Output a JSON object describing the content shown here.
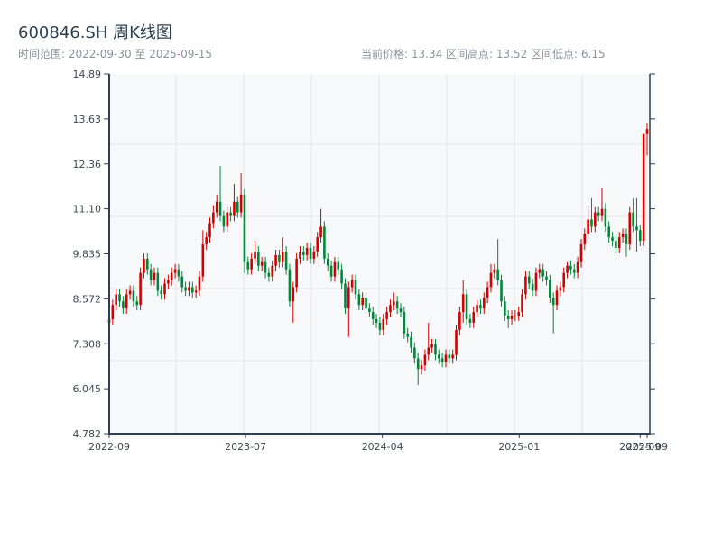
{
  "header": {
    "title": "600846.SH 周K线图",
    "range_text": "时间范围: 2022-09-30 至 2025-09-15",
    "stats_text": "当前价格: 13.34  区间高点: 13.52  区间低点: 6.15"
  },
  "chart_data": {
    "type": "candlestick",
    "title": "600846.SH 周K线图",
    "frequency": "weekly",
    "x_range": [
      "2022-09-30",
      "2025-09-15"
    ],
    "ylim": [
      4.782,
      14.89
    ],
    "y_ticks": [
      "14.89",
      "13.63",
      "12.36",
      "11.10",
      "9.835",
      "8.572",
      "7.308",
      "6.045",
      "4.782"
    ],
    "x_ticks": [
      {
        "label": "2022-09",
        "date": "2022-09-30"
      },
      {
        "label": "2023-07",
        "date": "2023-07-01"
      },
      {
        "label": "2024-04",
        "date": "2024-04-01"
      },
      {
        "label": "2025-01",
        "date": "2025-01-01"
      },
      {
        "label": "2025-09",
        "date": "2025-09-01"
      },
      {
        "label": "2025-09",
        "date": "2025-09-15"
      }
    ],
    "grid": true,
    "colors": {
      "up": "#d40000",
      "down": "#00873a",
      "axis": "#2c3e50",
      "plot_bg": "#f6f8fa",
      "grid": "#e1e4e8"
    },
    "ohlc_columns": [
      "open",
      "high",
      "low",
      "close"
    ],
    "ohlc": [
      [
        7.9,
        8.15,
        7.75,
        8.0
      ],
      [
        8.0,
        8.55,
        7.85,
        8.4
      ],
      [
        8.4,
        8.85,
        8.25,
        8.7
      ],
      [
        8.7,
        8.85,
        8.35,
        8.5
      ],
      [
        8.5,
        8.65,
        8.15,
        8.3
      ],
      [
        8.3,
        8.85,
        8.15,
        8.7
      ],
      [
        8.7,
        8.95,
        8.55,
        8.8
      ],
      [
        8.8,
        8.95,
        8.35,
        8.5
      ],
      [
        8.5,
        8.65,
        8.25,
        8.4
      ],
      [
        8.4,
        9.45,
        8.25,
        9.3
      ],
      [
        9.3,
        9.85,
        9.15,
        9.7
      ],
      [
        9.7,
        9.85,
        9.25,
        9.4
      ],
      [
        9.4,
        9.55,
        8.95,
        9.1
      ],
      [
        9.1,
        9.45,
        8.95,
        9.3
      ],
      [
        9.3,
        9.45,
        8.65,
        8.8
      ],
      [
        8.8,
        8.95,
        8.55,
        8.7
      ],
      [
        8.7,
        9.15,
        8.55,
        9.0
      ],
      [
        9.0,
        9.25,
        8.85,
        9.1
      ],
      [
        9.1,
        9.45,
        8.95,
        9.3
      ],
      [
        9.3,
        9.55,
        9.15,
        9.4
      ],
      [
        9.4,
        9.55,
        9.05,
        9.2
      ],
      [
        9.2,
        9.35,
        8.75,
        8.9
      ],
      [
        8.9,
        9.05,
        8.65,
        8.8
      ],
      [
        8.8,
        9.05,
        8.65,
        8.9
      ],
      [
        8.9,
        9.05,
        8.6,
        8.75
      ],
      [
        8.75,
        8.95,
        8.6,
        8.8
      ],
      [
        8.8,
        9.35,
        8.65,
        9.2
      ],
      [
        9.2,
        10.5,
        9.05,
        10.1
      ],
      [
        10.1,
        10.45,
        9.95,
        10.3
      ],
      [
        10.3,
        10.85,
        10.15,
        10.7
      ],
      [
        10.7,
        11.2,
        10.55,
        11.0
      ],
      [
        11.0,
        11.5,
        10.85,
        11.3
      ],
      [
        11.3,
        12.3,
        10.75,
        10.9
      ],
      [
        10.9,
        11.05,
        10.45,
        10.6
      ],
      [
        10.6,
        11.15,
        10.45,
        11.0
      ],
      [
        11.0,
        11.15,
        10.75,
        10.9
      ],
      [
        10.9,
        11.8,
        10.75,
        11.3
      ],
      [
        11.3,
        11.45,
        10.85,
        11.0
      ],
      [
        11.0,
        12.1,
        10.85,
        11.5
      ],
      [
        11.5,
        11.65,
        9.3,
        9.6
      ],
      [
        9.6,
        9.75,
        9.25,
        9.4
      ],
      [
        9.4,
        9.85,
        9.25,
        9.7
      ],
      [
        9.7,
        10.2,
        9.55,
        9.9
      ],
      [
        9.9,
        10.05,
        9.35,
        9.5
      ],
      [
        9.5,
        9.75,
        9.35,
        9.6
      ],
      [
        9.6,
        9.75,
        9.15,
        9.3
      ],
      [
        9.3,
        9.45,
        9.05,
        9.2
      ],
      [
        9.2,
        9.65,
        9.05,
        9.5
      ],
      [
        9.5,
        9.95,
        9.35,
        9.8
      ],
      [
        9.8,
        9.95,
        9.45,
        9.6
      ],
      [
        9.6,
        10.3,
        9.45,
        9.9
      ],
      [
        9.9,
        10.05,
        9.25,
        9.4
      ],
      [
        9.4,
        9.55,
        8.35,
        8.5
      ],
      [
        8.5,
        9.05,
        7.9,
        8.9
      ],
      [
        8.9,
        9.85,
        8.75,
        9.7
      ],
      [
        9.7,
        10.05,
        9.55,
        9.9
      ],
      [
        9.9,
        10.05,
        9.65,
        9.8
      ],
      [
        9.8,
        10.15,
        9.65,
        10.0
      ],
      [
        10.0,
        10.15,
        9.55,
        9.7
      ],
      [
        9.7,
        10.05,
        9.55,
        9.9
      ],
      [
        9.9,
        10.45,
        9.75,
        10.3
      ],
      [
        10.3,
        11.1,
        10.15,
        10.6
      ],
      [
        10.6,
        10.75,
        9.55,
        9.7
      ],
      [
        9.7,
        9.85,
        9.35,
        9.5
      ],
      [
        9.5,
        9.65,
        9.05,
        9.2
      ],
      [
        9.2,
        9.75,
        9.05,
        9.6
      ],
      [
        9.6,
        9.75,
        9.25,
        9.4
      ],
      [
        9.4,
        9.55,
        8.85,
        9.0
      ],
      [
        9.0,
        9.15,
        8.15,
        8.3
      ],
      [
        8.3,
        9.05,
        7.5,
        8.9
      ],
      [
        8.9,
        9.25,
        8.75,
        9.1
      ],
      [
        9.1,
        9.25,
        8.55,
        8.7
      ],
      [
        8.7,
        8.85,
        8.25,
        8.4
      ],
      [
        8.4,
        8.75,
        8.25,
        8.6
      ],
      [
        8.6,
        8.75,
        8.15,
        8.3
      ],
      [
        8.3,
        8.45,
        8.05,
        8.2
      ],
      [
        8.2,
        8.35,
        7.85,
        8.0
      ],
      [
        8.0,
        8.15,
        7.75,
        7.9
      ],
      [
        7.9,
        8.05,
        7.55,
        7.7
      ],
      [
        7.7,
        8.15,
        7.55,
        8.0
      ],
      [
        8.0,
        8.35,
        7.85,
        8.2
      ],
      [
        8.2,
        8.55,
        8.05,
        8.4
      ],
      [
        8.4,
        8.75,
        8.25,
        8.5
      ],
      [
        8.5,
        8.65,
        8.15,
        8.3
      ],
      [
        8.3,
        8.45,
        8.05,
        8.2
      ],
      [
        8.2,
        8.35,
        7.45,
        7.6
      ],
      [
        7.6,
        7.75,
        7.35,
        7.5
      ],
      [
        7.5,
        7.65,
        7.05,
        7.2
      ],
      [
        7.2,
        7.35,
        6.75,
        6.9
      ],
      [
        6.9,
        7.05,
        6.15,
        6.6
      ],
      [
        6.6,
        6.85,
        6.45,
        6.7
      ],
      [
        6.7,
        7.15,
        6.55,
        7.0
      ],
      [
        7.0,
        7.9,
        6.85,
        7.2
      ],
      [
        7.2,
        7.45,
        7.05,
        7.3
      ],
      [
        7.3,
        7.45,
        6.85,
        7.0
      ],
      [
        7.0,
        7.15,
        6.75,
        6.9
      ],
      [
        6.9,
        7.05,
        6.65,
        6.8
      ],
      [
        6.8,
        7.15,
        6.65,
        7.0
      ],
      [
        7.0,
        7.15,
        6.75,
        6.9
      ],
      [
        6.9,
        7.15,
        6.75,
        7.0
      ],
      [
        7.0,
        7.85,
        6.85,
        7.7
      ],
      [
        7.7,
        8.35,
        7.55,
        8.2
      ],
      [
        8.2,
        9.1,
        7.9,
        8.7
      ],
      [
        8.7,
        8.85,
        7.85,
        8.0
      ],
      [
        8.0,
        8.15,
        7.75,
        7.9
      ],
      [
        7.9,
        8.35,
        7.75,
        8.2
      ],
      [
        8.2,
        8.55,
        8.05,
        8.4
      ],
      [
        8.4,
        8.55,
        8.15,
        8.3
      ],
      [
        8.3,
        8.75,
        8.15,
        8.6
      ],
      [
        8.6,
        9.05,
        8.45,
        8.9
      ],
      [
        8.9,
        9.55,
        8.75,
        9.3
      ],
      [
        9.3,
        9.55,
        9.15,
        9.4
      ],
      [
        9.4,
        10.25,
        8.95,
        9.1
      ],
      [
        9.1,
        9.25,
        8.35,
        8.5
      ],
      [
        8.5,
        8.65,
        7.95,
        8.1
      ],
      [
        8.1,
        8.25,
        7.75,
        8.0
      ],
      [
        8.0,
        8.25,
        7.85,
        8.1
      ],
      [
        8.1,
        8.25,
        7.95,
        8.1
      ],
      [
        8.1,
        8.35,
        7.95,
        8.2
      ],
      [
        8.2,
        8.85,
        8.05,
        8.7
      ],
      [
        8.7,
        9.35,
        8.55,
        9.2
      ],
      [
        9.2,
        9.35,
        8.85,
        9.0
      ],
      [
        9.0,
        9.15,
        8.65,
        8.8
      ],
      [
        8.8,
        9.45,
        8.65,
        9.3
      ],
      [
        9.3,
        9.55,
        9.15,
        9.4
      ],
      [
        9.4,
        9.55,
        9.05,
        9.2
      ],
      [
        9.2,
        9.35,
        8.95,
        9.1
      ],
      [
        9.1,
        9.25,
        8.45,
        8.6
      ],
      [
        8.6,
        8.75,
        7.6,
        8.4
      ],
      [
        8.4,
        8.95,
        8.25,
        8.8
      ],
      [
        8.8,
        9.05,
        8.65,
        8.9
      ],
      [
        8.9,
        9.45,
        8.75,
        9.3
      ],
      [
        9.3,
        9.6,
        9.15,
        9.5
      ],
      [
        9.5,
        9.65,
        9.25,
        9.4
      ],
      [
        9.4,
        9.55,
        9.15,
        9.3
      ],
      [
        9.3,
        9.75,
        9.15,
        9.6
      ],
      [
        9.6,
        10.25,
        9.45,
        10.1
      ],
      [
        10.1,
        10.55,
        9.95,
        10.4
      ],
      [
        10.4,
        11.2,
        10.25,
        10.8
      ],
      [
        10.8,
        11.4,
        10.45,
        10.6
      ],
      [
        10.6,
        11.15,
        10.45,
        11.0
      ],
      [
        11.0,
        11.15,
        10.75,
        10.9
      ],
      [
        10.9,
        11.7,
        10.75,
        11.1
      ],
      [
        11.1,
        11.25,
        10.45,
        10.6
      ],
      [
        10.6,
        10.75,
        10.15,
        10.3
      ],
      [
        10.3,
        10.45,
        10.05,
        10.2
      ],
      [
        10.2,
        10.35,
        9.85,
        10.0
      ],
      [
        10.0,
        10.45,
        9.85,
        10.3
      ],
      [
        10.3,
        10.55,
        10.15,
        10.4
      ],
      [
        10.4,
        10.55,
        9.75,
        10.1
      ],
      [
        10.1,
        11.15,
        9.95,
        11.0
      ],
      [
        11.0,
        11.4,
        10.45,
        10.6
      ],
      [
        10.6,
        11.4,
        9.9,
        10.5
      ],
      [
        10.5,
        10.65,
        10.05,
        10.2
      ],
      [
        10.2,
        13.2,
        10.05,
        13.2
      ],
      [
        13.2,
        13.52,
        12.6,
        13.34
      ]
    ]
  }
}
